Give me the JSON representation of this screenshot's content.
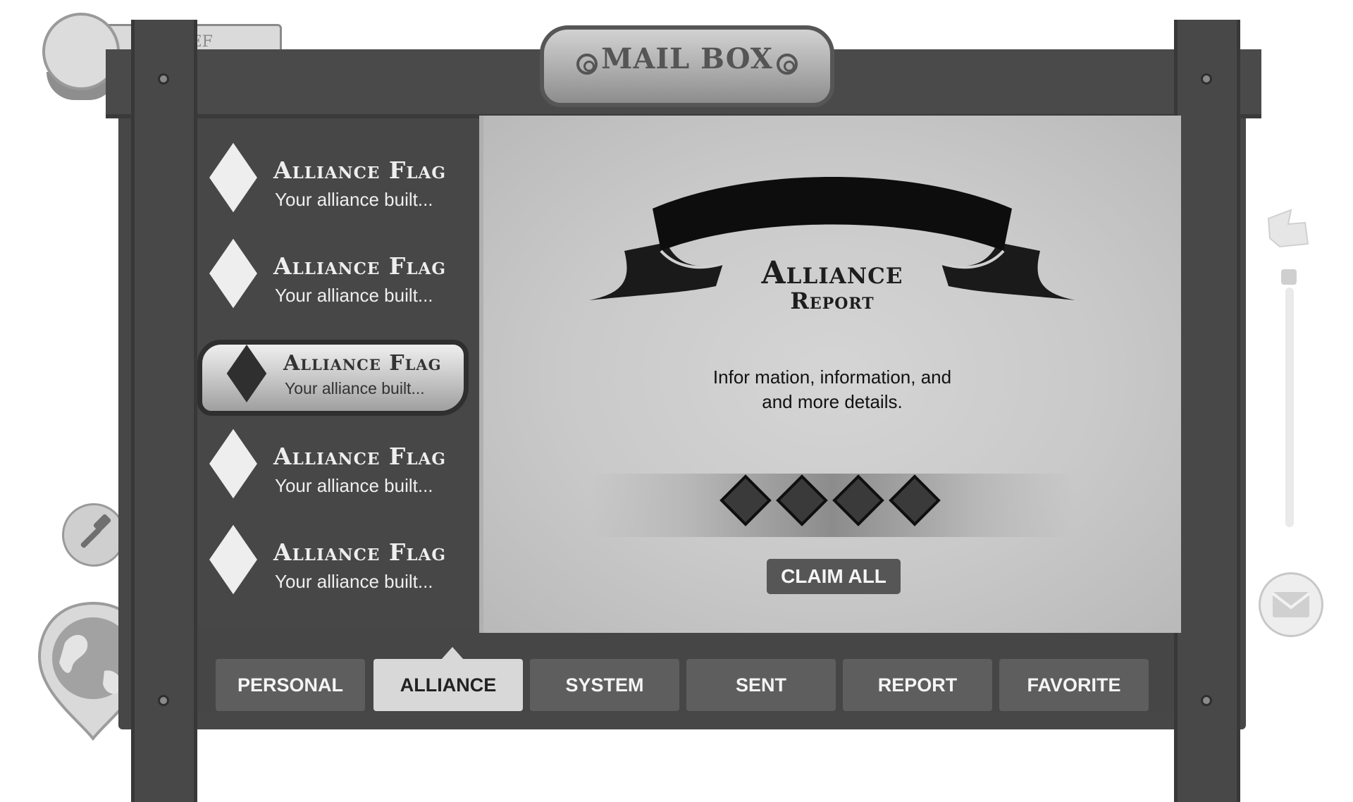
{
  "window": {
    "title": "MAIL BOX"
  },
  "hud": {
    "top_tab_label": "W   EF"
  },
  "mail_list": [
    {
      "title": "Alliance Flag",
      "preview": "Your alliance built...",
      "selected": false
    },
    {
      "title": "Alliance Flag",
      "preview": "Your alliance built...",
      "selected": false
    },
    {
      "title": "Alliance Flag",
      "preview": "Your alliance built...",
      "selected": true
    },
    {
      "title": "Alliance Flag",
      "preview": "Your alliance built...",
      "selected": false
    },
    {
      "title": "Alliance Flag",
      "preview": "Your alliance built...",
      "selected": false
    }
  ],
  "detail": {
    "heading": "Alliance",
    "subheading": "Report",
    "message_line1": "Infor mation, information, and",
    "message_line2": "and more details.",
    "rewards": [
      "diamond-icon",
      "diamond-icon",
      "diamond-icon",
      "diamond-icon"
    ],
    "claim_label": "CLAIM ALL"
  },
  "tabs": [
    {
      "label": "PERSONAL",
      "active": false
    },
    {
      "label": "ALLIANCE",
      "active": true
    },
    {
      "label": "SYSTEM",
      "active": false
    },
    {
      "label": "SENT",
      "active": false
    },
    {
      "label": "REPORT",
      "active": false
    },
    {
      "label": "FAVORITE",
      "active": false
    }
  ],
  "colors": {
    "frame": "#474747",
    "parchment": "#c9c9c9",
    "tab": "#5e5e5e",
    "tab_active": "#d8d8d8",
    "button": "#565656"
  }
}
